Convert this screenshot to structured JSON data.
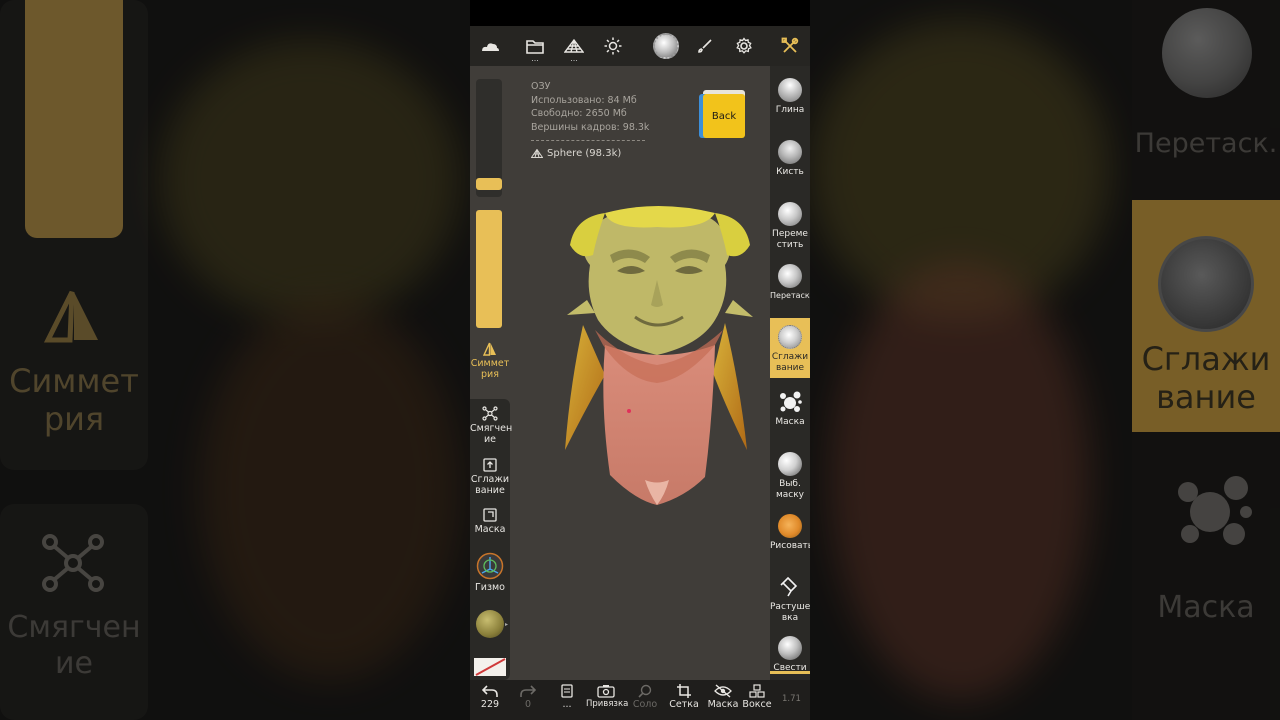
{
  "background": {
    "left": {
      "symmetry_label": "Симмет\nрия",
      "soften_label": "Смягчен\nие"
    },
    "right": {
      "drag_label": "Перетаск.",
      "smooth_label": "Сглажи\nвание",
      "mask_label": "Маска"
    }
  },
  "toolbar": {
    "icons": [
      "cloud-icon",
      "folder-icon",
      "mesh-layers-icon",
      "sun-icon",
      "sphere-material-icon",
      "brush-icon",
      "gear-icon",
      "tools-icon"
    ],
    "dots": "..."
  },
  "info": {
    "ram_title": "ОЗУ",
    "used": "Использовано: 84 Мб",
    "free": "Свободно: 2650 Мб",
    "vertices": "Вершины кадров: 98.3k",
    "mesh_name": "Sphere (98.3k)"
  },
  "back_cube": {
    "label": "Back"
  },
  "left_tools": {
    "radius_level": 0.93,
    "intensity_level": 1.0,
    "symmetry": "Симмет рия",
    "soften": "Смягчен ие",
    "smooth": "Сглажи вание",
    "mask": "Маска",
    "gizmo": "Гизмо"
  },
  "right_tools": [
    {
      "label": "Глина",
      "icon": "clay-brush-icon"
    },
    {
      "label": "Кисть",
      "icon": "standard-brush-icon"
    },
    {
      "label": "Переме стить",
      "icon": "move-brush-icon"
    },
    {
      "label": "Перетаск.",
      "icon": "drag-brush-icon"
    },
    {
      "label": "Сглажи вание",
      "icon": "smooth-brush-icon",
      "active": true
    },
    {
      "label": "Маска",
      "icon": "mask-splat-icon"
    },
    {
      "label": "Выб. маску",
      "icon": "select-mask-icon"
    },
    {
      "label": "Рисовать",
      "icon": "paint-brush-icon"
    },
    {
      "label": "Растуше вка",
      "icon": "smudge-icon"
    },
    {
      "label": "Свести",
      "icon": "flatten-icon"
    }
  ],
  "bottom": {
    "undo": "229",
    "redo": "0",
    "layers_dots": "...",
    "snap": "Привязка",
    "solo": "Соло",
    "grid": "Сетка",
    "mask": "Маска",
    "voxel": "Воксе",
    "version": "1.71"
  },
  "colors": {
    "accent": "#e8bf57",
    "panel": "#2a2926",
    "viewport": "#403d39"
  }
}
